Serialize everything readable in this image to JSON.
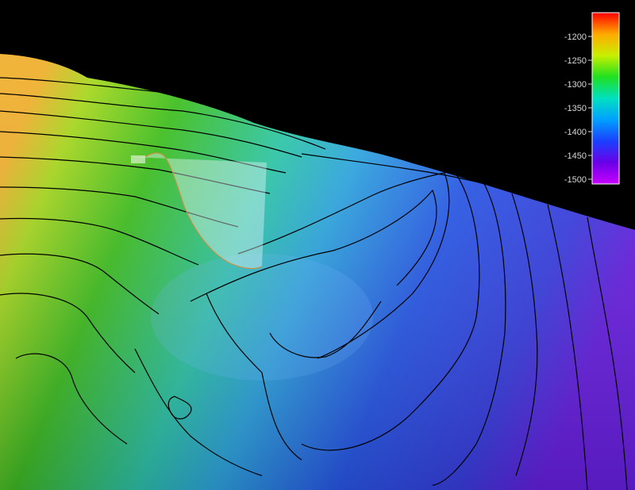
{
  "colorbar": {
    "ticks": [
      "-1200",
      "-1250",
      "-1300",
      "-1350",
      "-1400",
      "-1450",
      "-1500"
    ],
    "colors": [
      "#ff0000",
      "#ffaa00",
      "#c8f000",
      "#20e020",
      "#00e0c0",
      "#00a0ff",
      "#1a40ff",
      "#6a00e8",
      "#c800ff"
    ]
  },
  "terrain": {
    "colors": {
      "green": "#40c020",
      "cyan": "#30c8c8",
      "blue": "#2a5ae8",
      "violet": "#6a20e0",
      "contour": "#000000",
      "highlight": "#e6f6ff",
      "highlight_edge": "#d8893a"
    }
  }
}
